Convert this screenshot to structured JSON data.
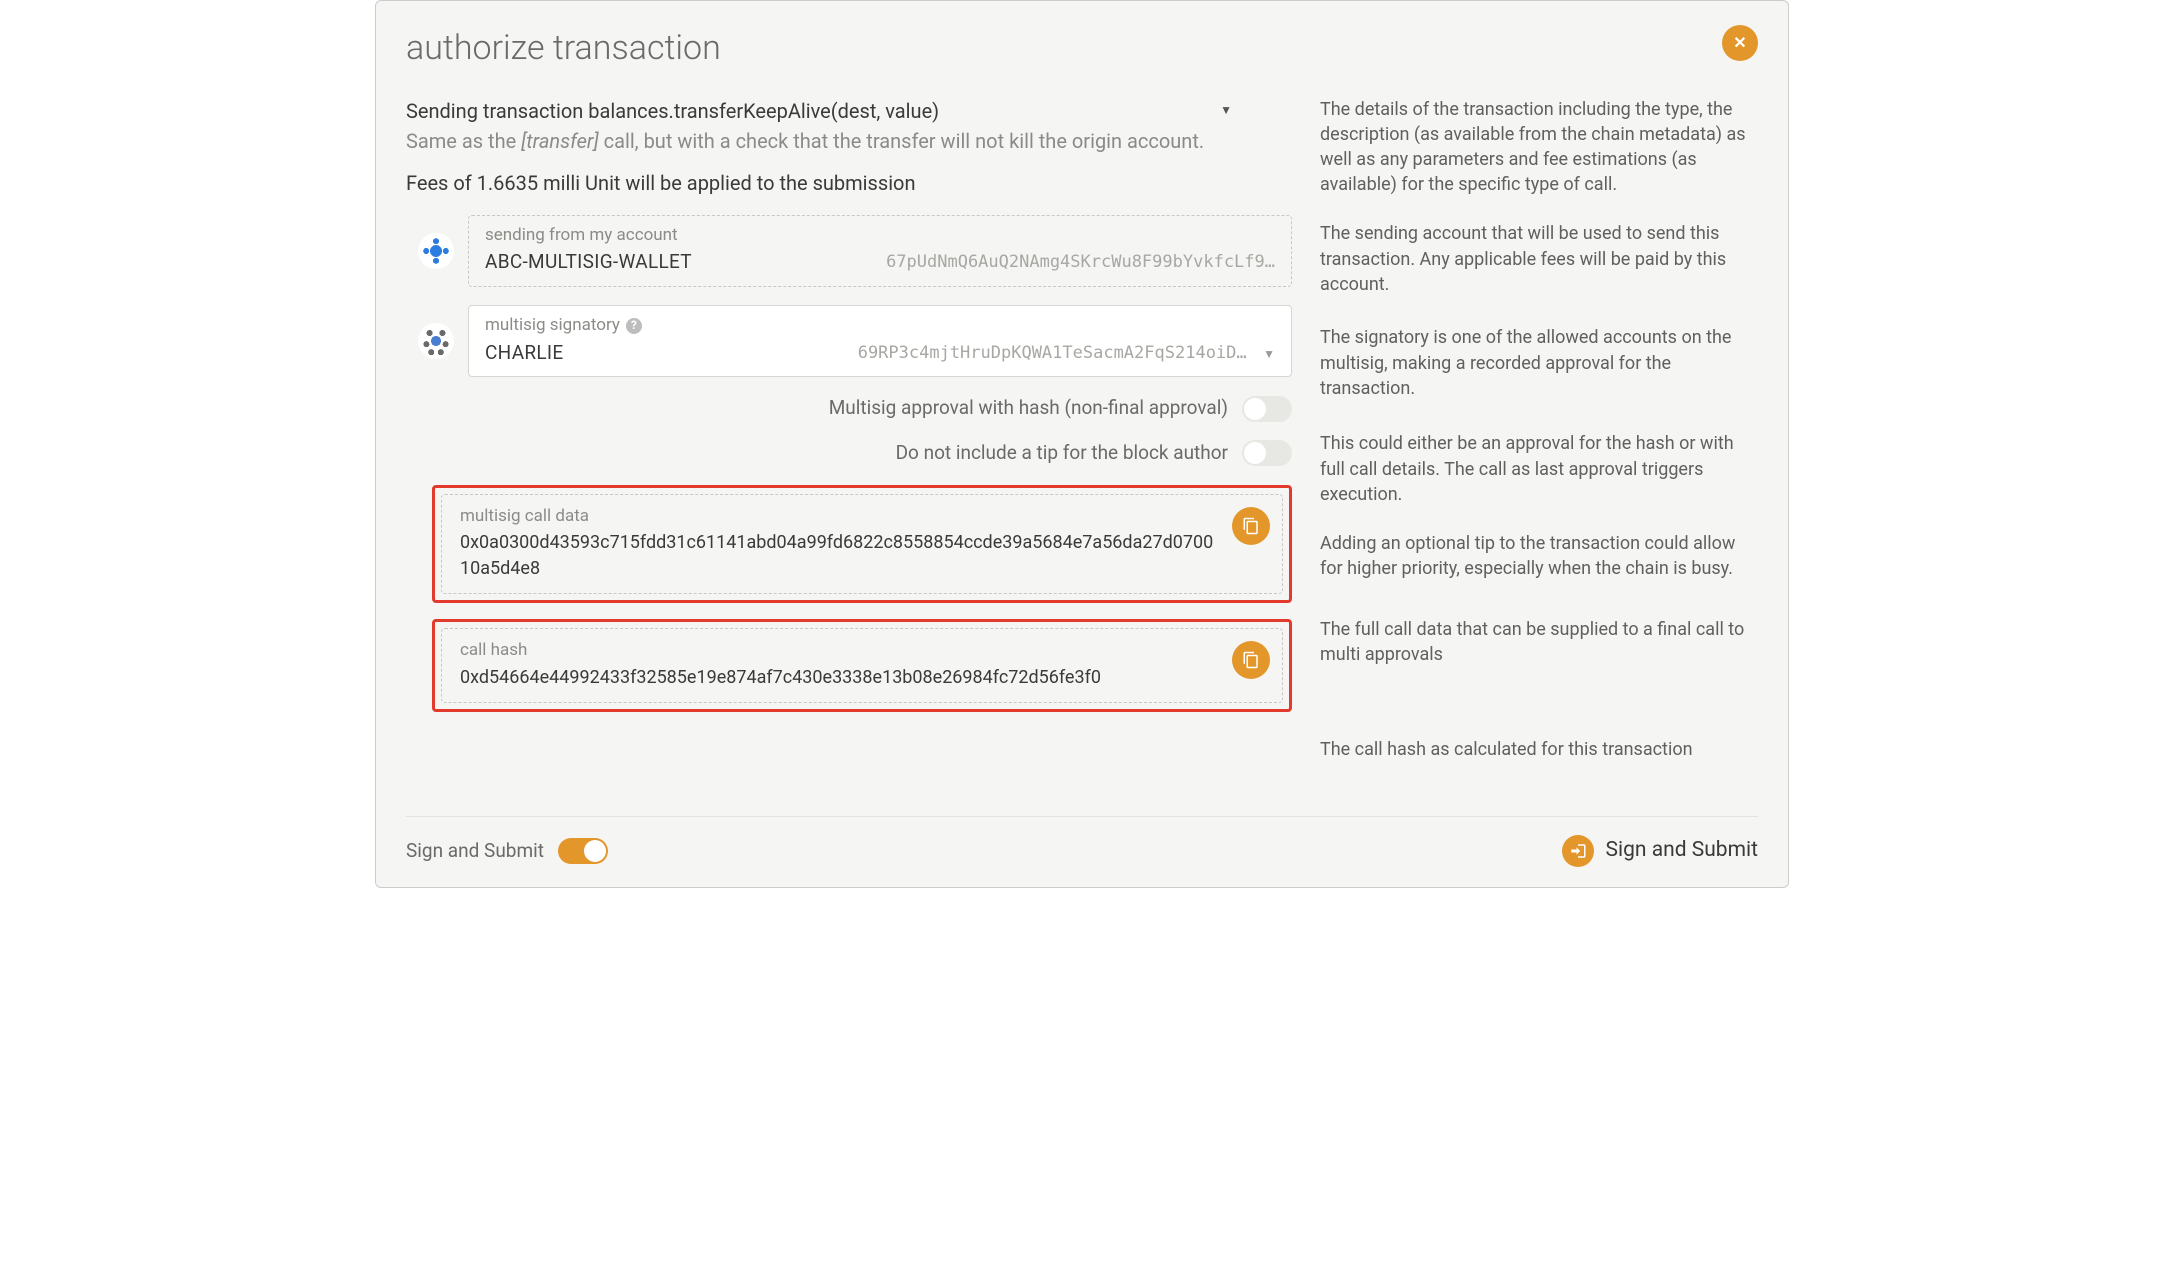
{
  "modal": {
    "title": "authorize transaction"
  },
  "tx": {
    "title_prefix": "Sending transaction ",
    "title_call": "balances.transferKeepAlive(dest, value)",
    "subtitle_pre": "Same as the ",
    "subtitle_italic": "[transfer]",
    "subtitle_post": " call, but with a check that the transfer will not kill the origin account.",
    "fees": "Fees of 1.6635 milli Unit will be applied to the submission"
  },
  "sendingFrom": {
    "label": "sending from my account",
    "name": "ABC-MULTISIG-WALLET",
    "address": "67pUdNmQ6AuQ2NAmg4SKrcWu8F99bYvkfcLf9…"
  },
  "signatory": {
    "label": "multisig signatory",
    "name": "CHARLIE",
    "address": "69RP3c4mjtHruDpKQWA1TeSacmA2FqS214oiD…"
  },
  "toggles": {
    "approvalHash": "Multisig approval with hash (non-final approval)",
    "noTip": "Do not include a tip for the block author"
  },
  "callData": {
    "label": "multisig call data",
    "value": "0x0a0300d43593c715fdd31c61141abd04a99fd6822c8558854ccde39a5684e7a56da27d070010a5d4e8"
  },
  "callHash": {
    "label": "call hash",
    "value": "0xd54664e44992433f32585e19e874af7c430e3338e13b08e26984fc72d56fe3f0"
  },
  "descriptions": {
    "details": "The details of the transaction including the type, the description (as available from the chain metadata) as well as any parameters and fee estimations (as available) for the specific type of call.",
    "sending": "The sending account that will be used to send this transaction. Any applicable fees will be paid by this account.",
    "signatory": "The signatory is one of the allowed accounts on the multisig, making a recorded approval for the transaction.",
    "approval": "This could either be an approval for the hash or with full call details. The call as last approval triggers execution.",
    "tip": "Adding an optional tip to the transaction could allow for higher priority, especially when the chain is busy.",
    "callData": "The full call data that can be supplied to a final call to multi approvals",
    "callHash": "The call hash as calculated for this transaction"
  },
  "footer": {
    "signLabel": "Sign and Submit",
    "submitBtn": "Sign and Submit"
  }
}
